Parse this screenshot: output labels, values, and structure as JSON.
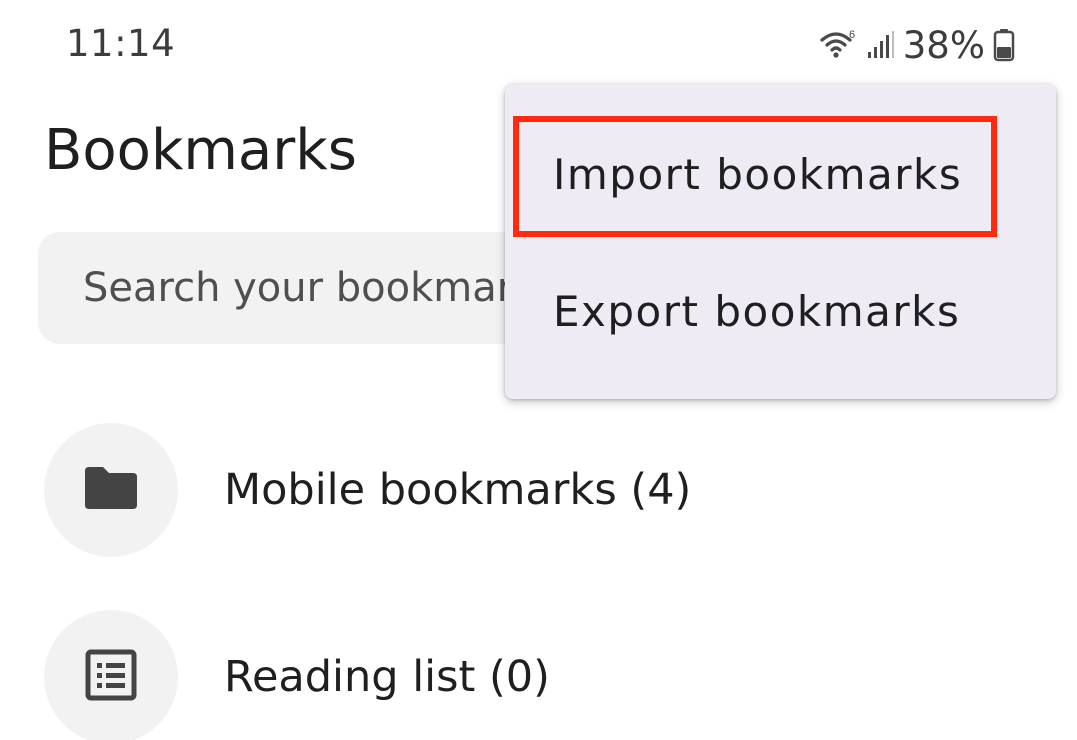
{
  "status_bar": {
    "time": "11:14",
    "battery": "38%",
    "icons": [
      "wifi-icon",
      "signal-icon",
      "battery-icon"
    ]
  },
  "page": {
    "title": "Bookmarks"
  },
  "search": {
    "placeholder": "Search your bookmarks"
  },
  "list": {
    "items": [
      {
        "label": "Mobile bookmarks (4)",
        "icon": "folder-icon"
      },
      {
        "label": "Reading list (0)",
        "icon": "reading-list-icon"
      }
    ]
  },
  "menu": {
    "items": [
      {
        "label": "Import bookmarks",
        "highlighted": true
      },
      {
        "label": "Export bookmarks",
        "highlighted": false
      }
    ],
    "highlight_color": "#ff2a10",
    "background": "#efebf4"
  }
}
